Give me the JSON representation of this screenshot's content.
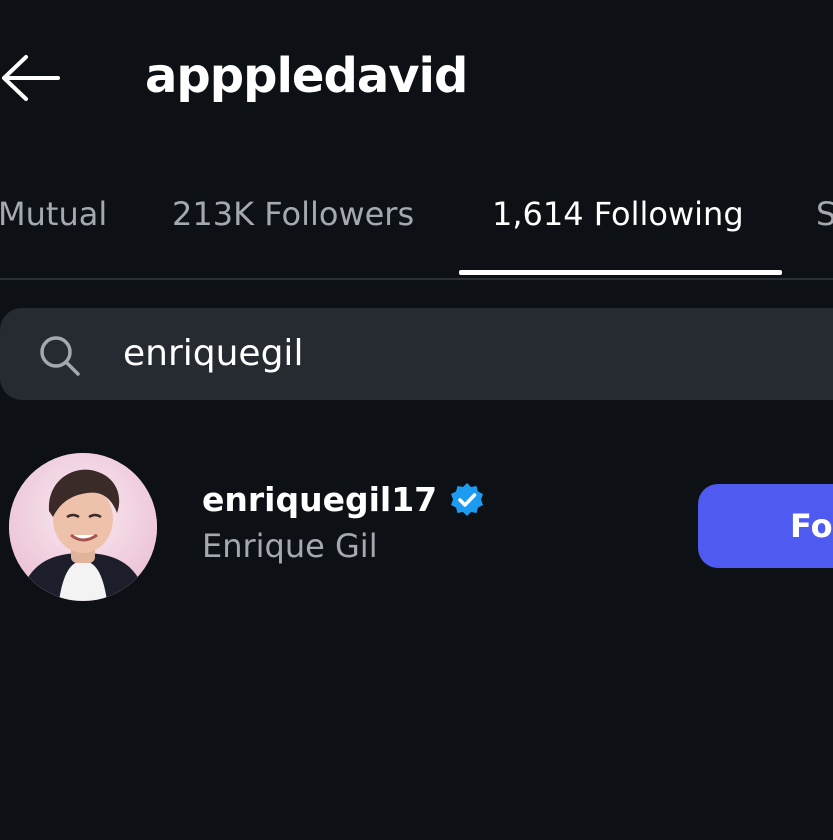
{
  "header": {
    "back_icon": "arrow-left-icon",
    "username": "apppledavid"
  },
  "tabs": [
    {
      "label": "Mutual",
      "active": false
    },
    {
      "label": "213K Followers",
      "active": false
    },
    {
      "label": "1,614 Following",
      "active": true
    },
    {
      "label": "S",
      "active": false
    }
  ],
  "search": {
    "icon": "search-icon",
    "value": "enriquegil"
  },
  "results": [
    {
      "username": "enriquegil17",
      "display_name": "Enrique Gil",
      "verified": true,
      "button_label": "Fo"
    }
  ],
  "colors": {
    "background": "#0d1015",
    "accent_button": "#4f5bf0",
    "verified_badge": "#1d9bf0",
    "search_bg": "#262a31",
    "muted_text": "#a4a9b1"
  }
}
